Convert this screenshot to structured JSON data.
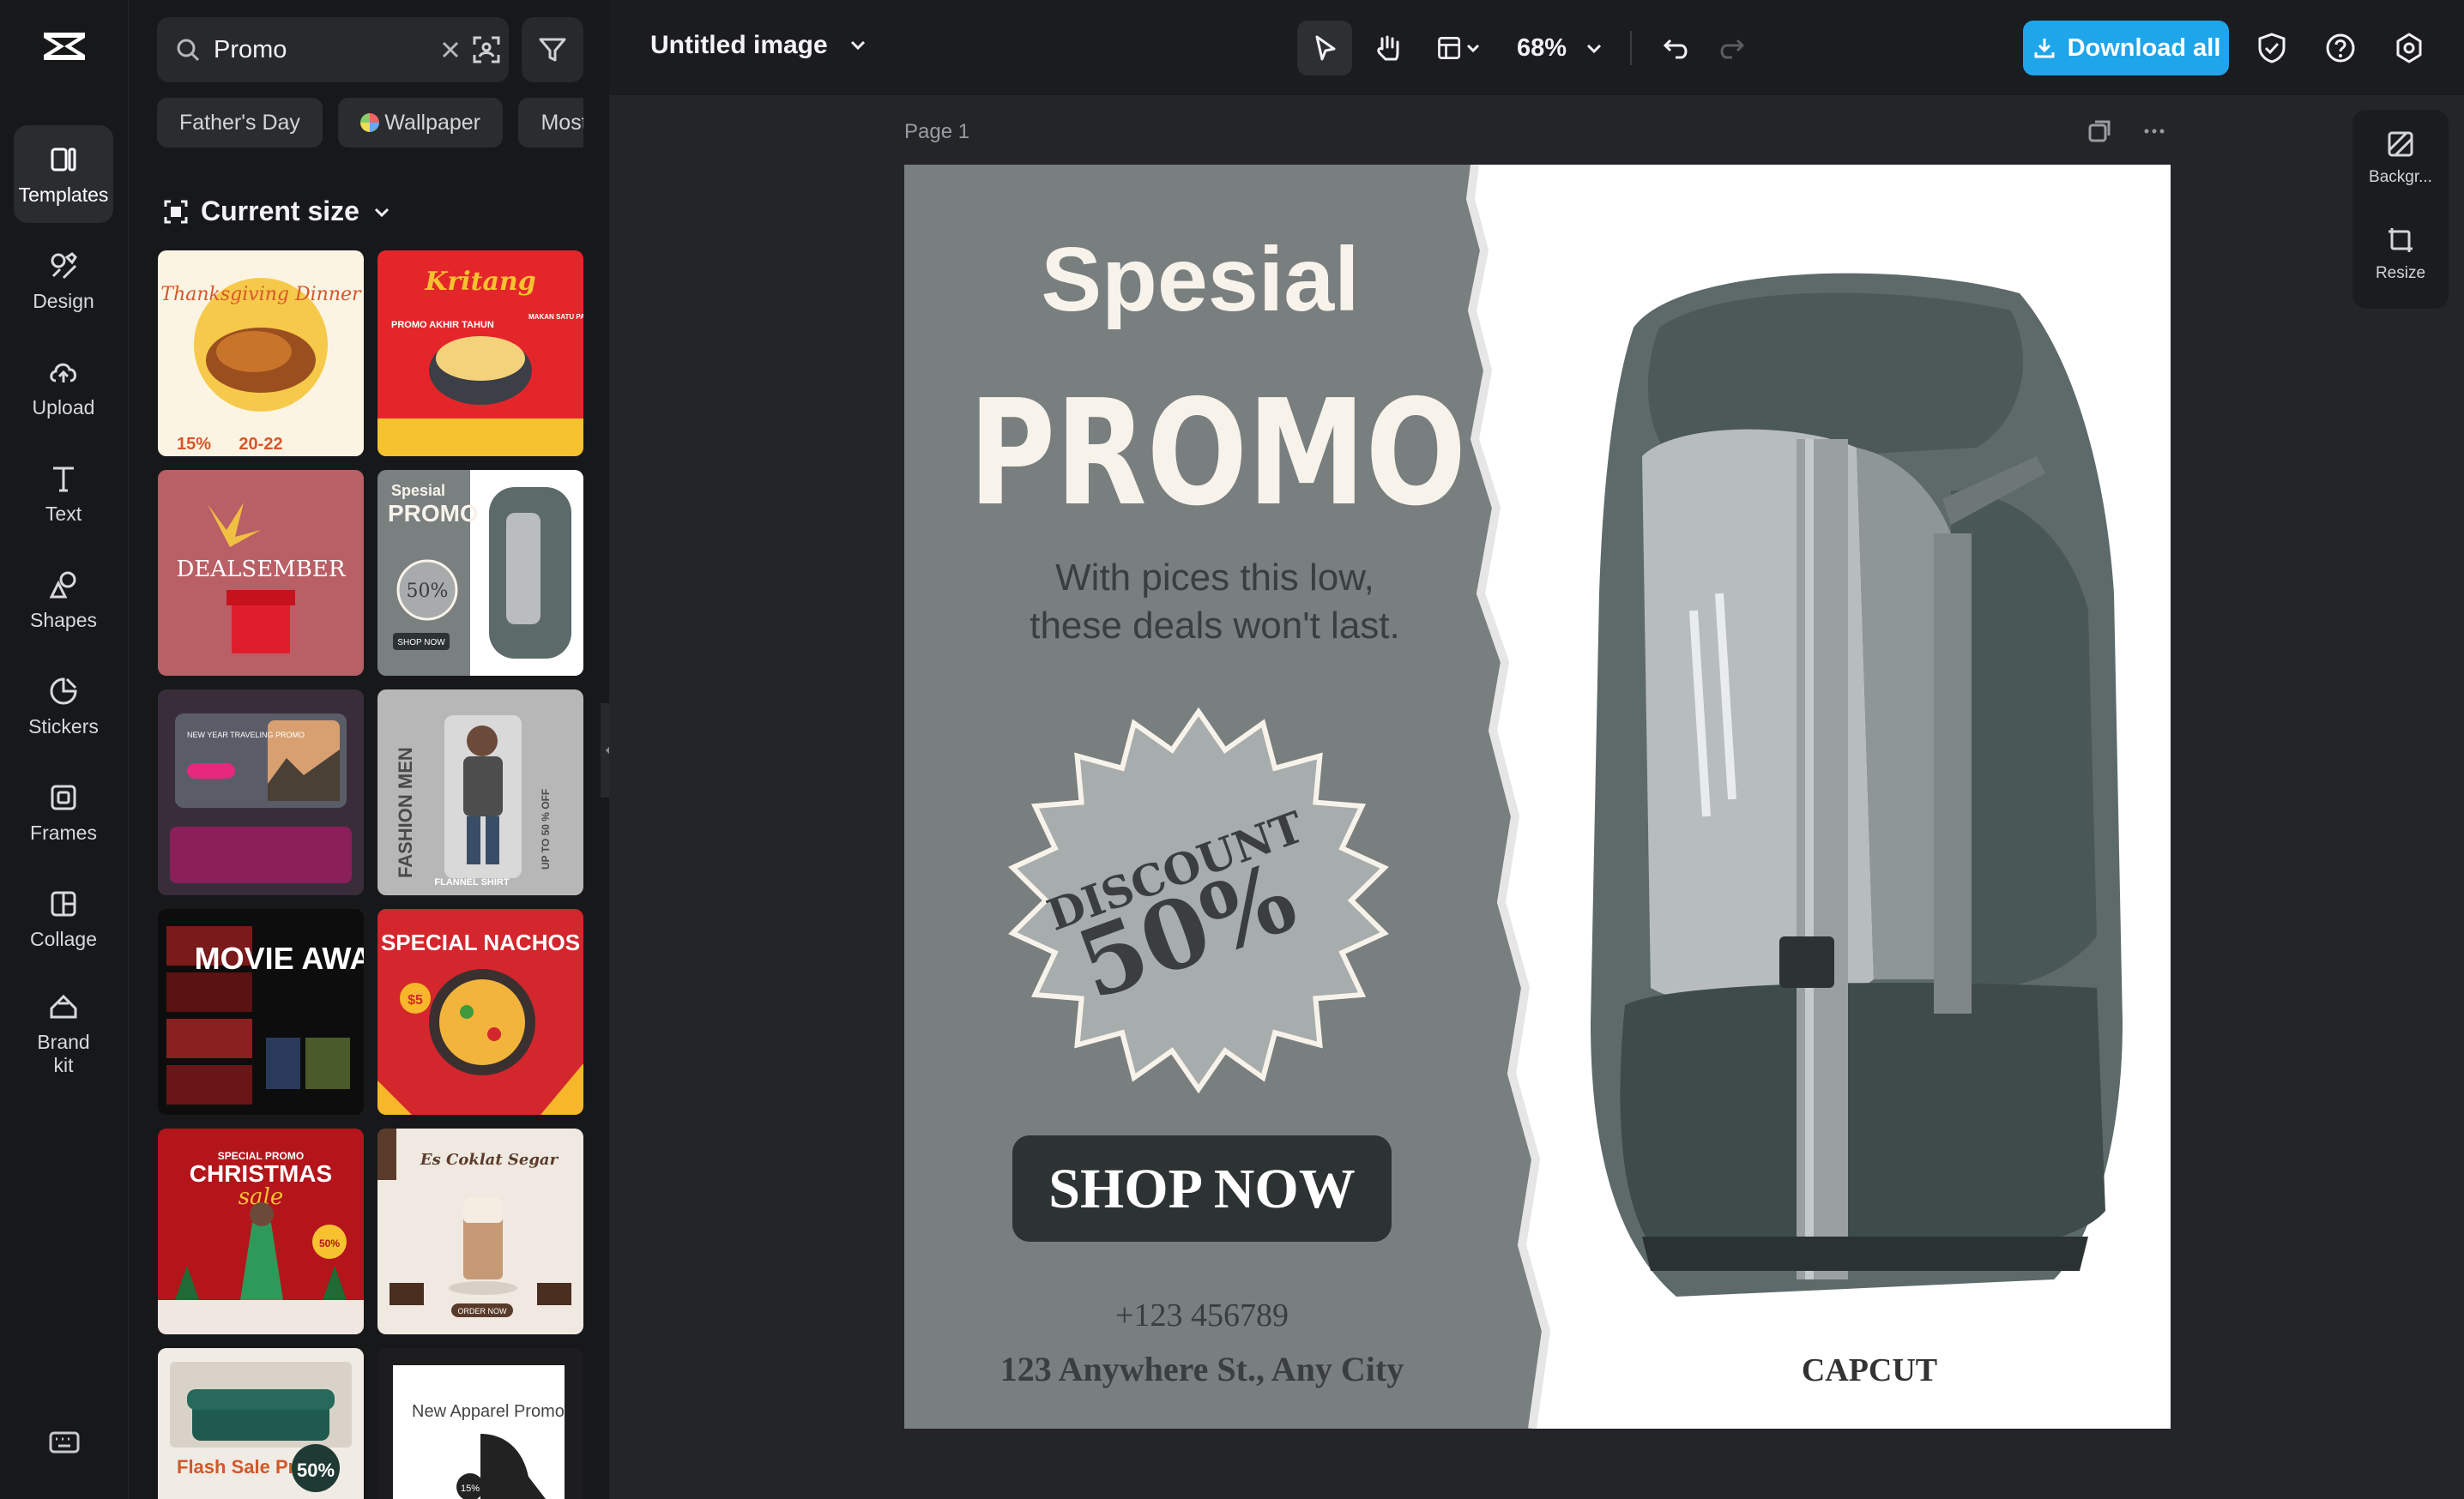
{
  "rail": {
    "items": [
      {
        "label": "Templates"
      },
      {
        "label": "Design"
      },
      {
        "label": "Upload"
      },
      {
        "label": "Text"
      },
      {
        "label": "Shapes"
      },
      {
        "label": "Stickers"
      },
      {
        "label": "Frames"
      },
      {
        "label": "Collage"
      },
      {
        "label": "Brand kit"
      }
    ]
  },
  "search": {
    "value": "Promo"
  },
  "chips": [
    "Father's Day",
    "Wallpaper",
    "Most"
  ],
  "panel": {
    "size_title": "Current size"
  },
  "templates": [
    {
      "title": "Thanksgiving Dinner",
      "t1": "15%",
      "t2": "20-22"
    },
    {
      "title": "Kritang",
      "t1": "PROMO AKHIR TAHUN",
      "t2": "MAKAN SATU PASTI KURANG"
    },
    {
      "title": "DEALSEMBER"
    },
    {
      "title": "Spesial",
      "t1": "PROMO",
      "t2": "50%",
      "t3": "SHOP NOW"
    },
    {
      "title": "NEW YEAR TRAVELING PROMO"
    },
    {
      "title": "FASHION MEN",
      "t1": "FLANNEL SHIRT",
      "t2": "UP TO 50 % OFF"
    },
    {
      "title": "MOVIE AWARD"
    },
    {
      "title": "SPECIAL NACHOS",
      "t1": "$5"
    },
    {
      "title": "CHRISTMAS",
      "t1": "SPECIAL PROMO",
      "t2": "sale",
      "t3": "50%"
    },
    {
      "title": "Es Coklat Segar",
      "t1": "ORDER NOW"
    },
    {
      "title": "Flash Sale Promo",
      "t1": "50%"
    },
    {
      "title": "New Apparel Promo",
      "t1": "15%"
    }
  ],
  "topbar": {
    "doc_title": "Untitled image",
    "zoom": "68%",
    "download_label": "Download all"
  },
  "canvas": {
    "page_label": "Page 1"
  },
  "design": {
    "heading1": "Spesial",
    "heading2": "PROMO",
    "subtext1": "With pices this low,",
    "subtext2": "these deals won't last.",
    "badge_line1": "DISCOUNT",
    "badge_line2": "50%",
    "cta": "SHOP NOW",
    "phone": "+123 456789",
    "address": "123 Anywhere St., Any City",
    "brand": "CAPCUT",
    "left_bg": "#797e7e",
    "text_cream": "#f7f3ea",
    "text_dark": "#3b3e3f",
    "button_bg": "#2d3233"
  },
  "right_tools": [
    {
      "label": "Backgr..."
    },
    {
      "label": "Resize"
    }
  ],
  "colors": {
    "accent": "#1fa5e9",
    "bg": "#18191b",
    "panel": "#17181a"
  }
}
